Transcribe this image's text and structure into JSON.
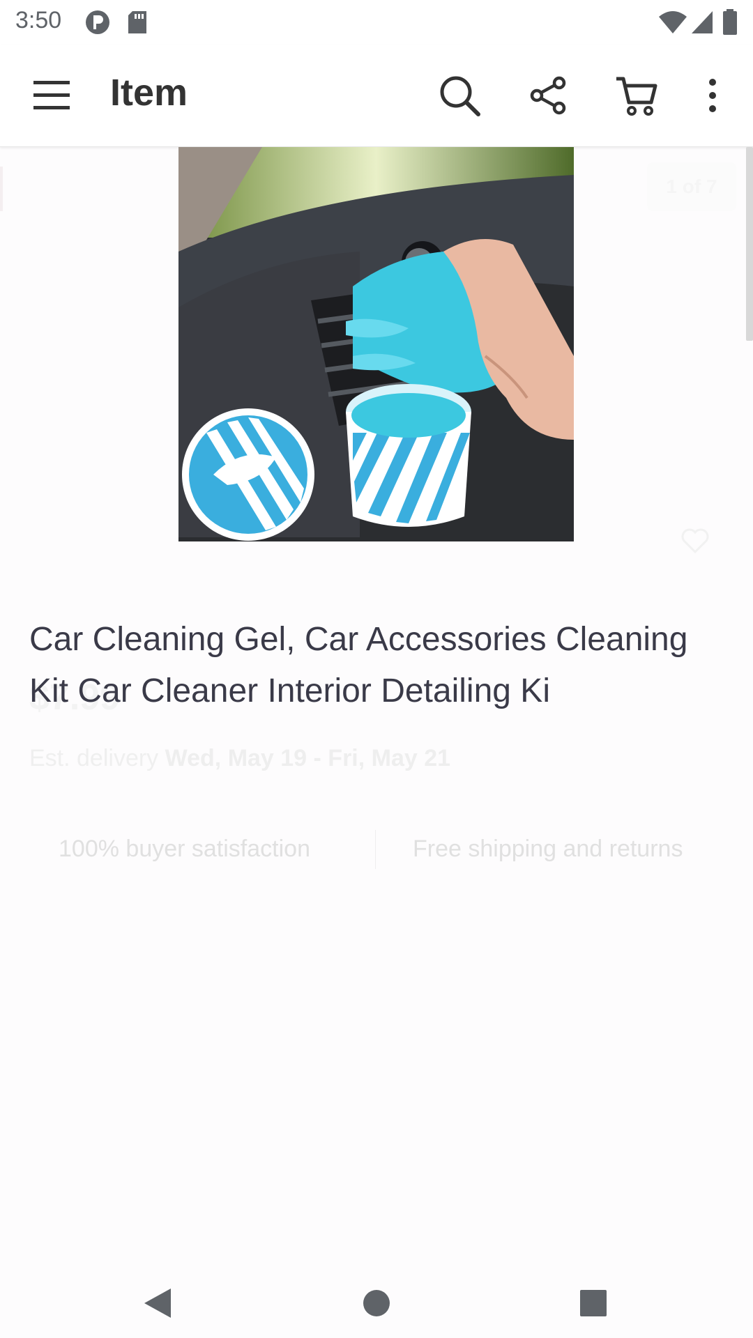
{
  "status_bar": {
    "time": "3:50",
    "left_icons": [
      "data-saver-icon",
      "sd-card-icon"
    ],
    "right_icons": [
      "wifi-icon",
      "signal-icon",
      "battery-icon"
    ]
  },
  "app_bar": {
    "title": "Item",
    "menu_icon": "hamburger-menu-icon",
    "actions": [
      "search-icon",
      "share-icon",
      "cart-icon",
      "more-vert-icon"
    ]
  },
  "gallery": {
    "counter": "1 of 7",
    "image_alt": "Car Cleaning Gel product photo"
  },
  "product": {
    "title": "Car Cleaning Gel, Car Accessories Cleaning Kit Car Cleaner Interior Detailing Ki",
    "price": "$7.99",
    "delivery_label": "Est. delivery",
    "delivery_dates": "Wed, May 19 - Fri, May 21"
  },
  "badges": {
    "satisfaction": "100% buyer satisfaction",
    "shipping": "Free shipping and returns"
  },
  "nav_bar": {
    "buttons": [
      "back-icon",
      "home-icon",
      "recents-icon"
    ]
  },
  "colors": {
    "gel_blue": "#3cc8e0",
    "text_dark": "#3a3a48",
    "icon_dark": "#333333"
  }
}
